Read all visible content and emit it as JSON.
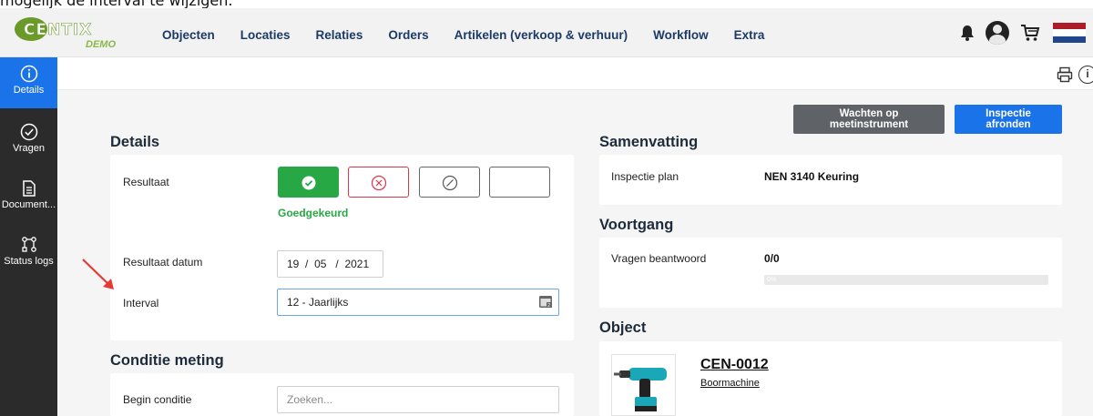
{
  "caption": "mogelijk de interval te wijzigen.",
  "brand": {
    "logo_text": "CENTIX",
    "logo_sub": "DEMO"
  },
  "nav": {
    "items": [
      "Objecten",
      "Locaties",
      "Relaties",
      "Orders",
      "Artikelen (verkoop & verhuur)",
      "Workflow",
      "Extra"
    ]
  },
  "top_icons": [
    "bell-icon",
    "user-icon",
    "cart-icon",
    "flag-nl-icon"
  ],
  "sidebar": {
    "items": [
      {
        "label": "Details",
        "icon": "info-icon",
        "active": true
      },
      {
        "label": "Vragen",
        "icon": "check-circle-icon",
        "active": false
      },
      {
        "label": "Document...",
        "icon": "document-icon",
        "active": false
      },
      {
        "label": "Status logs",
        "icon": "status-logs-icon",
        "active": false
      }
    ]
  },
  "actions": {
    "wait_button": "Wachten op meetinstrument",
    "finish_button": "Inspectie afronden"
  },
  "details": {
    "title": "Details",
    "result_label": "Resultaat",
    "result_status": "Goedgekeurd",
    "result_date_label": "Resultaat datum",
    "result_date": {
      "day": "19",
      "month": "05",
      "year": "2021"
    },
    "interval_label": "Interval",
    "interval_value": "12 - Jaarlijks"
  },
  "condition": {
    "title": "Conditie meting",
    "begin_label": "Begin conditie",
    "begin_placeholder": "Zoeken..."
  },
  "summary": {
    "title": "Samenvatting",
    "plan_label": "Inspectie plan",
    "plan_value": "NEN 3140 Keuring"
  },
  "progress": {
    "title": "Voortgang",
    "answered_label": "Vragen beantwoord",
    "answered_value": "0/0",
    "percent_text": "0%",
    "fraction": 0
  },
  "object": {
    "title": "Object",
    "code": "CEN-0012",
    "description": "Boormachine"
  },
  "colors": {
    "primary": "#1a73e8",
    "success": "#28a745",
    "danger": "#dc3545",
    "sidebar": "#2b2b2b",
    "nav_text": "#1d3a66"
  }
}
